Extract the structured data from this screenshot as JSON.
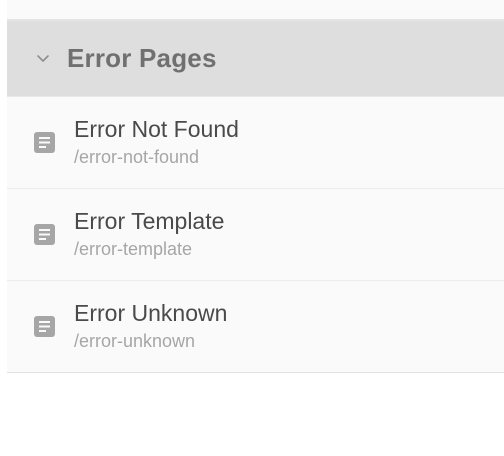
{
  "group": {
    "title": "Error Pages",
    "expanded": true,
    "chevron_icon": "chevron-down-icon"
  },
  "pages": [
    {
      "title": "Error Not Found",
      "path": "/error-not-found",
      "icon": "document-icon"
    },
    {
      "title": "Error Template",
      "path": "/error-template",
      "icon": "document-icon"
    },
    {
      "title": "Error Unknown",
      "path": "/error-unknown",
      "icon": "document-icon"
    }
  ],
  "colors": {
    "header_bg": "#dedede",
    "item_bg": "#fafafa",
    "title_text": "#4a4a4a",
    "path_text": "#a6a6a6",
    "icon": "#a6a6a6"
  }
}
